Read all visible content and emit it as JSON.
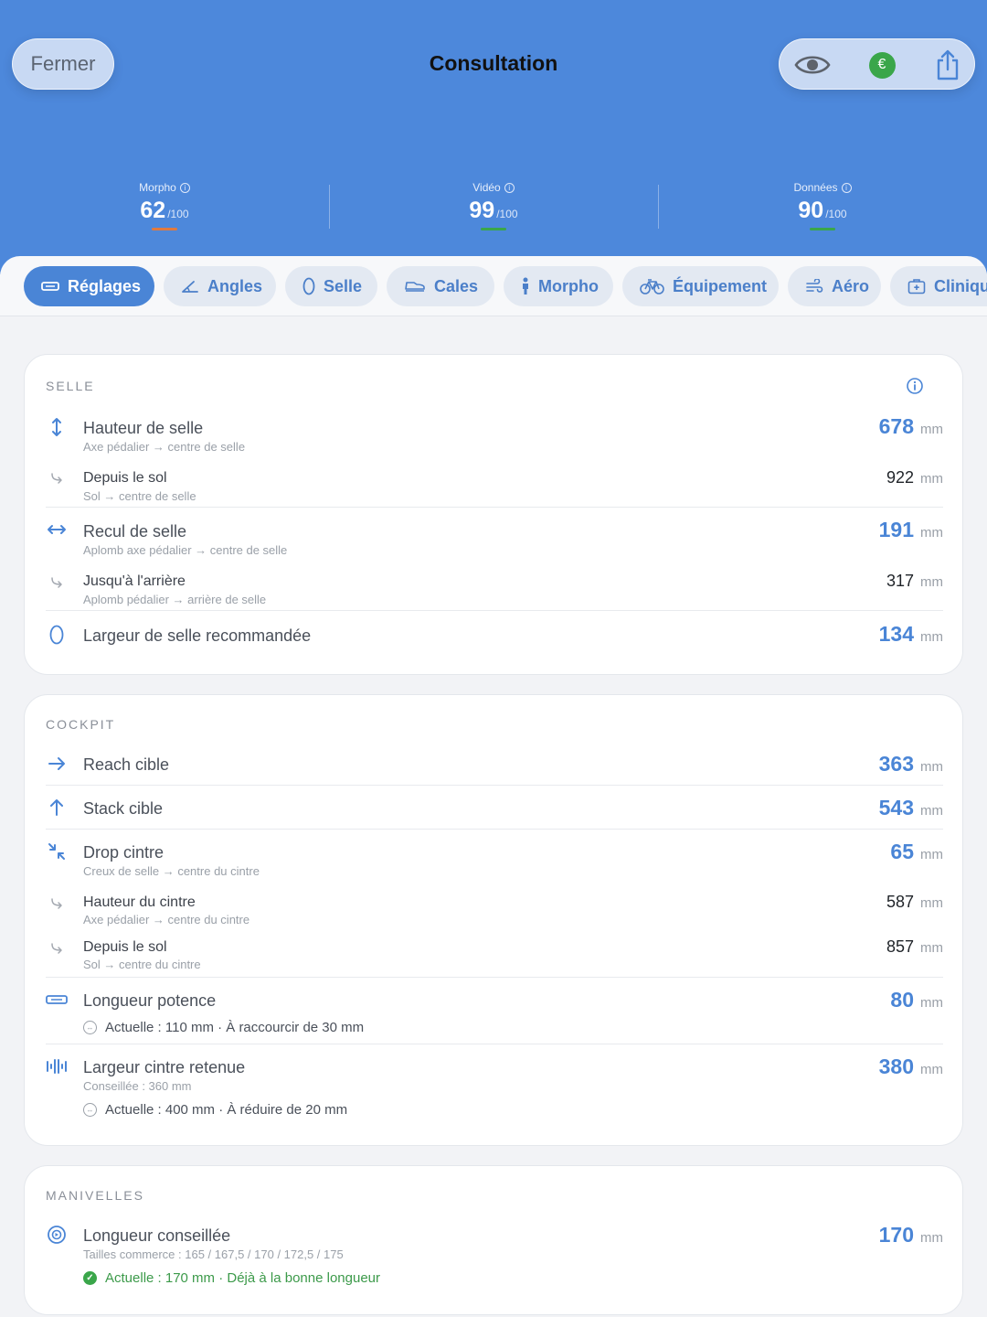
{
  "header": {
    "close_label": "Fermer",
    "title": "Consultation",
    "actions": [
      {
        "icon": "eye-icon"
      },
      {
        "icon": "euro-icon",
        "glyph": "€",
        "color": "#3aa64a"
      },
      {
        "icon": "share-icon"
      }
    ]
  },
  "scores": [
    {
      "label": "Morpho",
      "value": "62",
      "denominator": "/100",
      "bar_color": "#e07a3f"
    },
    {
      "label": "Vidéo",
      "value": "99",
      "denominator": "/100",
      "bar_color": "#3aa64a"
    },
    {
      "label": "Données",
      "value": "90",
      "denominator": "/100",
      "bar_color": "#3aa64a"
    }
  ],
  "tabs": [
    {
      "label": "Réglages",
      "icon": "ruler-icon",
      "active": true
    },
    {
      "label": "Angles",
      "icon": "angle-icon"
    },
    {
      "label": "Selle",
      "icon": "saddle-icon"
    },
    {
      "label": "Cales",
      "icon": "shoe-icon"
    },
    {
      "label": "Morpho",
      "icon": "person-icon"
    },
    {
      "label": "Équipement",
      "icon": "bicycle-icon"
    },
    {
      "label": "Aéro",
      "icon": "wind-icon"
    },
    {
      "label": "Clinique",
      "icon": "medical-kit-icon"
    }
  ],
  "sections": {
    "selle": {
      "title": "SELLE",
      "rows": [
        {
          "label": "Hauteur de selle",
          "sub": "Axe pédalier → centre de selle",
          "value": "678",
          "unit": "mm",
          "icon": "vertical-arrows-icon"
        },
        {
          "label": "Depuis le sol",
          "sub": "Sol → centre de selle",
          "value": "922",
          "unit": "mm",
          "icon": "sub-arrow-icon"
        },
        {
          "label": "Recul de selle",
          "sub": "Aplomb axe pédalier → centre de selle",
          "value": "191",
          "unit": "mm",
          "icon": "horizontal-arrows-icon"
        },
        {
          "label": "Jusqu'à l'arrière",
          "sub": "Aplomb pédalier → arrière de selle",
          "value": "317",
          "unit": "mm",
          "icon": "sub-arrow-icon"
        },
        {
          "label": "Largeur de selle recommandée",
          "value": "134",
          "unit": "mm",
          "icon": "saddle-outline-icon"
        }
      ]
    },
    "cockpit": {
      "title": "COCKPIT",
      "rows": [
        {
          "label": "Reach cible",
          "value": "363",
          "unit": "mm",
          "icon": "arrow-right-icon"
        },
        {
          "label": "Stack cible",
          "value": "543",
          "unit": "mm",
          "icon": "arrow-up-icon"
        },
        {
          "label": "Drop cintre",
          "sub": "Creux de selle → centre du cintre",
          "value": "65",
          "unit": "mm",
          "icon": "compress-arrows-icon"
        },
        {
          "label": "Hauteur du cintre",
          "sub": "Axe pédalier → centre du cintre",
          "value": "587",
          "unit": "mm",
          "icon": "sub-arrow-icon"
        },
        {
          "label": "Depuis le sol",
          "sub": "Sol → centre du cintre",
          "value": "857",
          "unit": "mm",
          "icon": "sub-arrow-icon"
        },
        {
          "label": "Longueur potence",
          "value": "80",
          "unit": "mm",
          "icon": "ruler-icon",
          "note": "Actuelle : 110 mm · À raccourcir de 30 mm"
        },
        {
          "label": "Largeur cintre retenue",
          "sub": "Conseillée : 360 mm",
          "value": "380",
          "unit": "mm",
          "icon": "width-bars-icon",
          "note": "Actuelle : 400 mm · À réduire de 20 mm"
        }
      ]
    },
    "manivelles": {
      "title": "MANIVELLES",
      "rows": [
        {
          "label": "Longueur conseillée",
          "sub": "Tailles commerce : 165 / 167,5 / 170 / 172,5 / 175",
          "value": "170",
          "unit": "mm",
          "icon": "crank-icon",
          "note": "Actuelle : 170 mm · Déjà à la bonne longueur",
          "note_status": "ok"
        }
      ]
    }
  },
  "colors": {
    "header": "#4d88db",
    "accent": "#4a85d6",
    "ok": "#3aa64a",
    "warning": "#e07a3f"
  }
}
